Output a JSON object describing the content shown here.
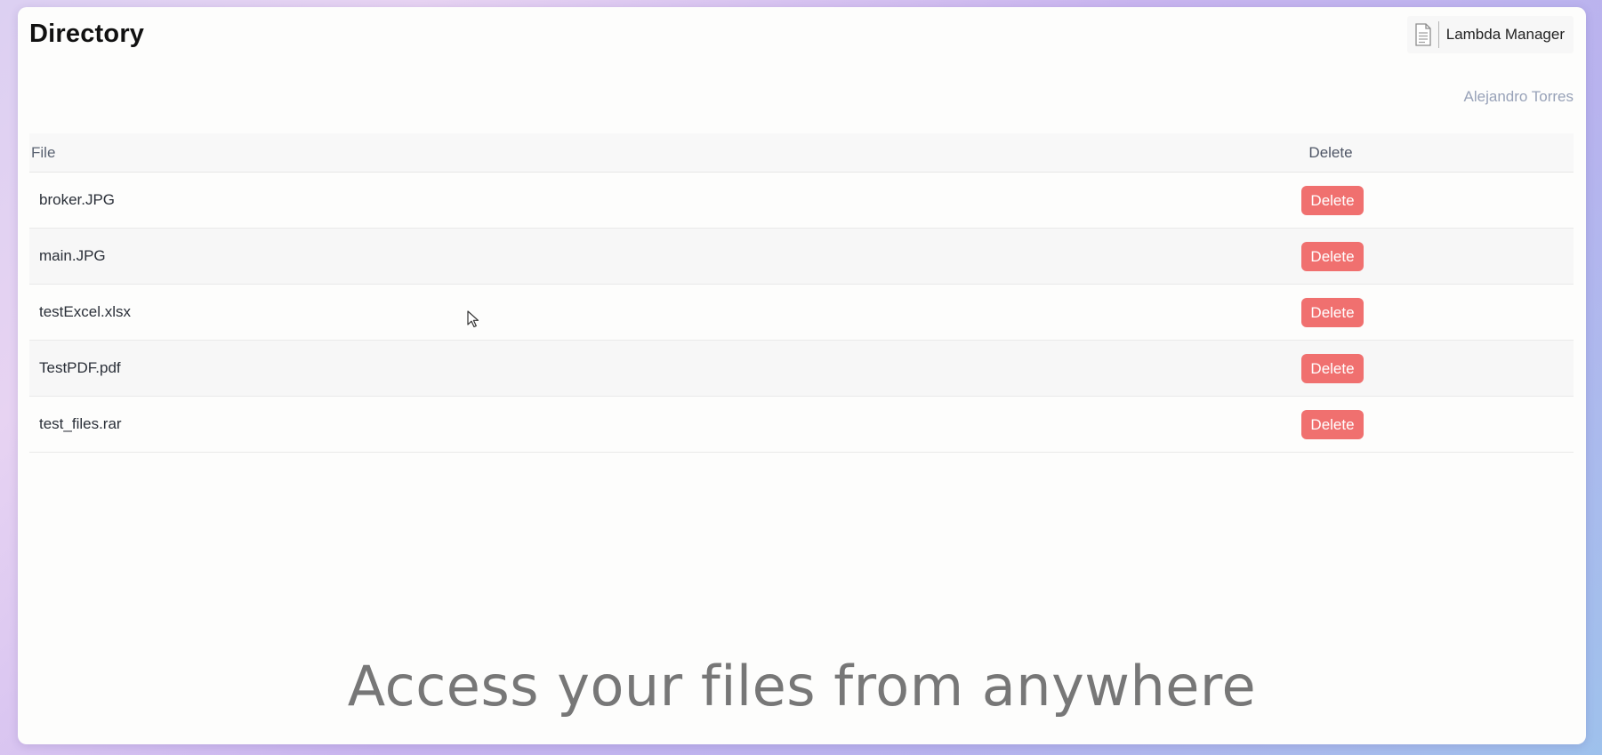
{
  "header": {
    "title": "Directory",
    "app_name": "Lambda Manager",
    "app_icon": "document-icon",
    "user_name": "Alejandro Torres"
  },
  "table": {
    "columns": [
      "File",
      "Delete"
    ],
    "rows": [
      {
        "file": "broker.JPG",
        "action": "Delete"
      },
      {
        "file": "main.JPG",
        "action": "Delete"
      },
      {
        "file": "testExcel.xlsx",
        "action": "Delete"
      },
      {
        "file": "TestPDF.pdf",
        "action": "Delete"
      },
      {
        "file": "test_files.rar",
        "action": "Delete"
      }
    ]
  },
  "tagline": "Access your files from anywhere",
  "colors": {
    "delete_button": "#f0706f",
    "user_name": "#98a2b8",
    "tagline": "#777777"
  }
}
